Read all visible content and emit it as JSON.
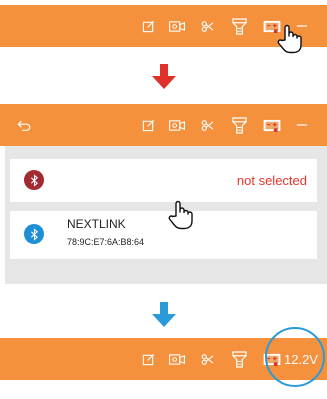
{
  "colors": {
    "accent": "#f5903d",
    "alert_arrow": "#e0302a",
    "info_arrow": "#2a9ad8",
    "bt_unselected": "#a22a33",
    "bt_selected": "#1d8fd6",
    "not_selected_text": "#e8352b"
  },
  "toolbar": {
    "icons": [
      "edit-icon",
      "video-record-icon",
      "scissors-icon",
      "flashlight-icon",
      "battery-connector-icon",
      "minimize-icon"
    ]
  },
  "device_list": {
    "status_row": {
      "icon": "bluetooth-icon",
      "status_text": "not selected"
    },
    "devices": [
      {
        "icon": "bluetooth-icon",
        "name": "NEXTLINK",
        "mac": "78:9C:E7:6A:B8:64"
      }
    ]
  },
  "result_bar": {
    "voltage": "12.2V"
  }
}
